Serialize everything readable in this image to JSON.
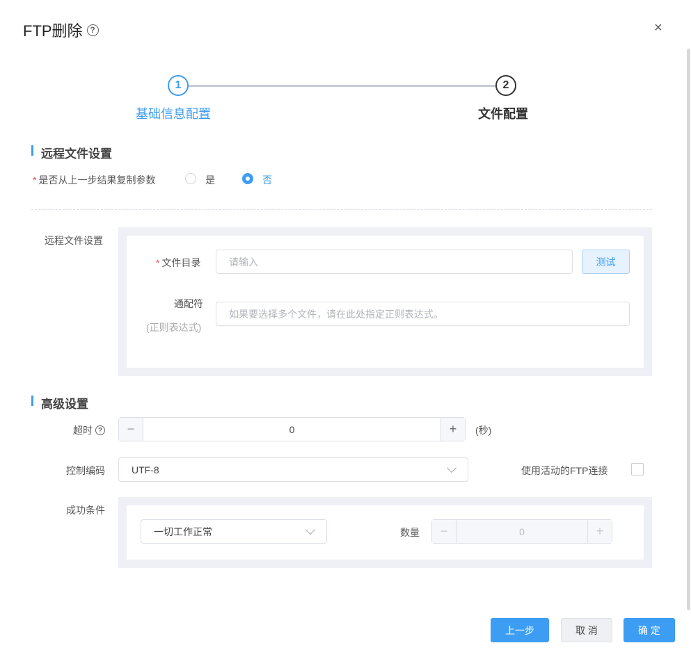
{
  "dialog": {
    "title": "FTP删除",
    "help": "?",
    "close": "×"
  },
  "steps": [
    {
      "number": "1",
      "label": "基础信息配置"
    },
    {
      "number": "2",
      "label": "文件配置"
    }
  ],
  "remote_section": {
    "title": "远程文件设置",
    "copy_params": {
      "required": "*",
      "label": "是否从上一步结果复制参数",
      "options": [
        "是",
        "否"
      ],
      "selected": "否"
    },
    "group_label": "远程文件设置",
    "file_dir": {
      "required": "*",
      "label": "文件目录",
      "placeholder": "请输入",
      "test_button": "测试"
    },
    "wildcard": {
      "label": "通配符",
      "sublabel": "(正则表达式)",
      "placeholder": "如果要选择多个文件，请在此处指定正则表达式。"
    }
  },
  "advanced": {
    "title": "高级设置",
    "timeout": {
      "label": "超时",
      "value": "0",
      "unit": "(秒)",
      "minus": "−",
      "plus": "+"
    },
    "encoding": {
      "label": "控制编码",
      "value": "UTF-8"
    },
    "active_ftp": {
      "label": "使用活动的FTP连接",
      "checked": false
    },
    "success": {
      "label": "成功条件",
      "condition": "一切工作正常",
      "count_label": "数量",
      "count_value": "0",
      "minus": "−",
      "plus": "+"
    }
  },
  "footer": {
    "prev": "上一步",
    "cancel": "取 消",
    "confirm": "确 定"
  },
  "colors": {
    "accent": "#3d9df2",
    "required": "#e34d4d"
  }
}
